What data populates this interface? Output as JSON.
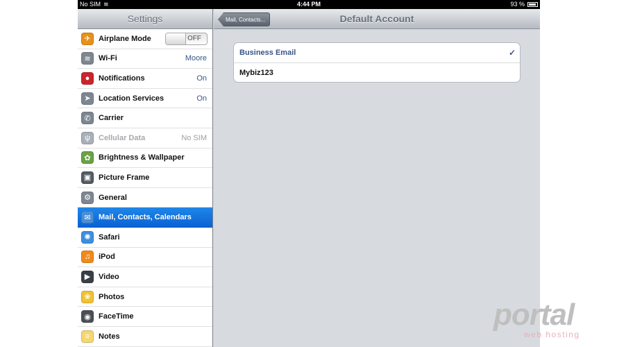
{
  "status_bar": {
    "carrier": "No SIM",
    "time": "4:44 PM",
    "battery": "93 %",
    "battery_level": 0.93
  },
  "master": {
    "title": "Settings",
    "items": [
      {
        "name": "airplane-mode",
        "label": "Airplane Mode",
        "toggle": "OFF",
        "icon": "airplane-icon",
        "icon_color": "#e8901b",
        "glyph": "✈"
      },
      {
        "name": "wifi",
        "label": "Wi-Fi",
        "value": "Moore",
        "icon": "wifi-icon",
        "icon_color": "#7e8791",
        "glyph": "≋"
      },
      {
        "name": "notifications",
        "label": "Notifications",
        "value": "On",
        "icon": "notifications-icon",
        "icon_color": "#c9262b",
        "glyph": "●"
      },
      {
        "name": "location-services",
        "label": "Location Services",
        "value": "On",
        "icon": "location-icon",
        "icon_color": "#7e8791",
        "glyph": "➤"
      },
      {
        "name": "carrier",
        "label": "Carrier",
        "icon": "phone-icon",
        "icon_color": "#7e8791",
        "glyph": "✆"
      },
      {
        "name": "cellular-data",
        "label": "Cellular Data",
        "value": "No SIM",
        "icon": "antenna-icon",
        "icon_color": "#aab0b8",
        "glyph": "ψ",
        "disabled": true
      },
      {
        "name": "brightness-wallpaper",
        "label": "Brightness & Wallpaper",
        "icon": "flower-icon",
        "icon_color": "#6aa245",
        "glyph": "✿"
      },
      {
        "name": "picture-frame",
        "label": "Picture Frame",
        "icon": "picture-frame-icon",
        "icon_color": "#555b62",
        "glyph": "▣"
      },
      {
        "name": "general",
        "label": "General",
        "icon": "gear-icon",
        "icon_color": "#7e8791",
        "glyph": "⚙"
      },
      {
        "name": "mail-contacts-calendars",
        "label": "Mail, Contacts, Calendars",
        "icon": "mail-icon",
        "icon_color": "#4a8fd8",
        "glyph": "✉",
        "selected": true
      },
      {
        "name": "safari",
        "label": "Safari",
        "icon": "compass-icon",
        "icon_color": "#3d8fe0",
        "glyph": "✺"
      },
      {
        "name": "ipod",
        "label": "iPod",
        "icon": "music-icon",
        "icon_color": "#f08a1c",
        "glyph": "♫"
      },
      {
        "name": "video",
        "label": "Video",
        "icon": "clapper-icon",
        "icon_color": "#3a3f46",
        "glyph": "▶"
      },
      {
        "name": "photos",
        "label": "Photos",
        "icon": "sunflower-icon",
        "icon_color": "#f2c232",
        "glyph": "❀"
      },
      {
        "name": "facetime",
        "label": "FaceTime",
        "icon": "camera-icon",
        "icon_color": "#4a4f56",
        "glyph": "◉"
      },
      {
        "name": "notes",
        "label": "Notes",
        "icon": "notepad-icon",
        "icon_color": "#f4d770",
        "glyph": "≡"
      }
    ]
  },
  "detail": {
    "back_label": "Mail, Contacts...",
    "title": "Default Account",
    "accounts": [
      {
        "name": "Business Email",
        "checked": true
      },
      {
        "name": "Mybiz123",
        "checked": false
      }
    ],
    "checkmark": "✓"
  },
  "watermark": {
    "brand": "portal",
    "sub": "web hosting"
  }
}
